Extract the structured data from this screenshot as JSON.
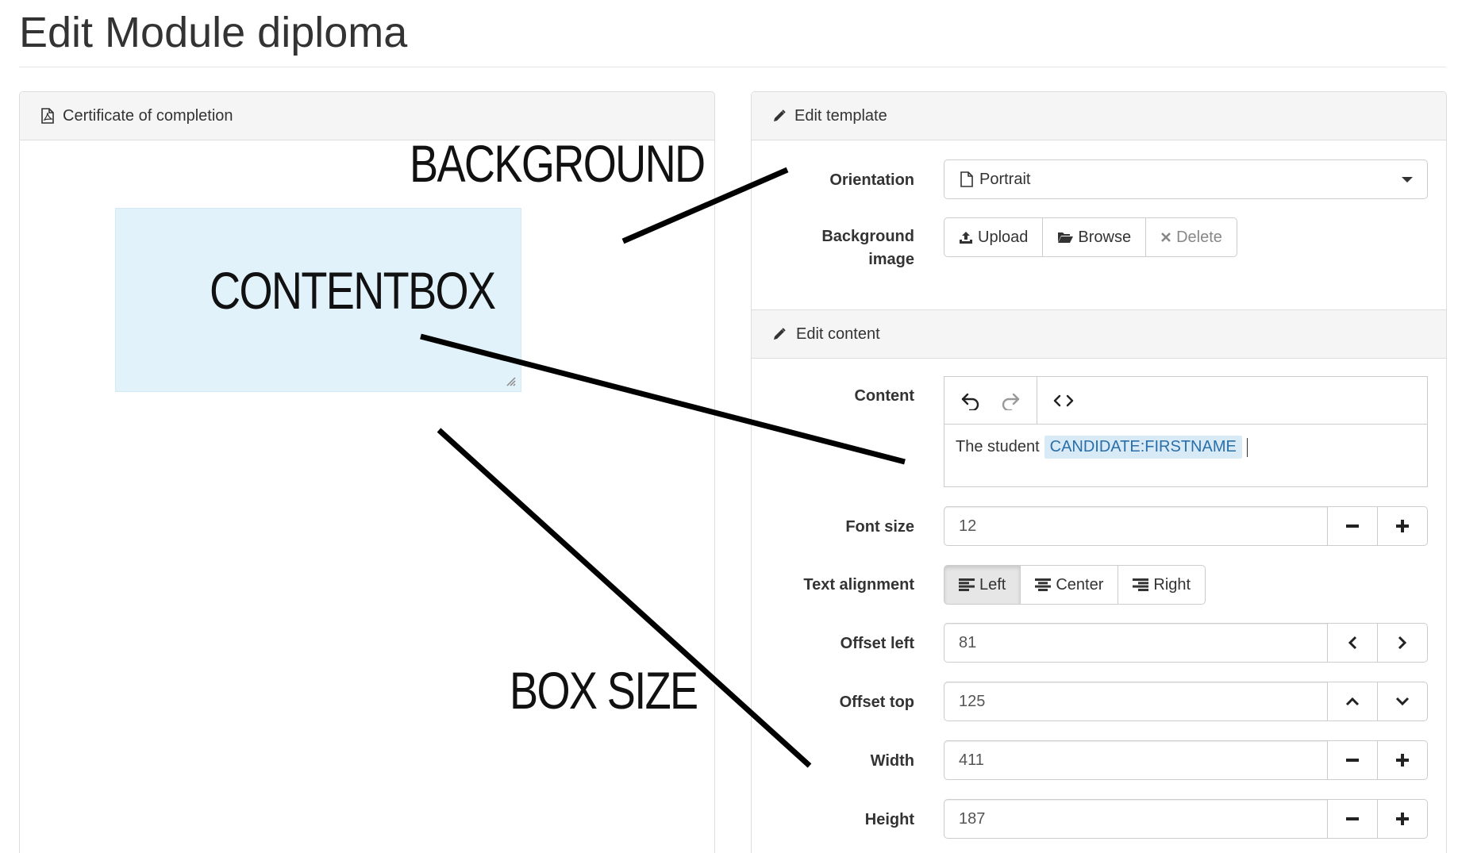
{
  "page": {
    "title": "Edit Module diploma"
  },
  "left_panel": {
    "title": "Certificate of completion",
    "preview": {
      "contentbox_label": "CONTENTBOX"
    }
  },
  "annotations": {
    "background": "BACKGROUND",
    "box_size": "BOX SIZE"
  },
  "template": {
    "title": "Edit template",
    "orientation": {
      "label": "Orientation",
      "value": "Portrait"
    },
    "background_image": {
      "label_line1": "Background",
      "label_line2": "image",
      "buttons": {
        "upload": "Upload",
        "browse": "Browse",
        "delete": "Delete"
      }
    }
  },
  "content": {
    "title": "Edit content",
    "content_label": "Content",
    "editor_text": "The student",
    "editor_token": "CANDIDATE:FIRSTNAME",
    "font_size": {
      "label": "Font size",
      "value": "12"
    },
    "text_alignment": {
      "label": "Text alignment",
      "options": {
        "left": "Left",
        "center": "Center",
        "right": "Right"
      },
      "selected": "Left"
    },
    "offset_left": {
      "label": "Offset left",
      "value": "81"
    },
    "offset_top": {
      "label": "Offset top",
      "value": "125"
    },
    "width": {
      "label": "Width",
      "value": "411"
    },
    "height": {
      "label": "Height",
      "value": "187"
    }
  }
}
